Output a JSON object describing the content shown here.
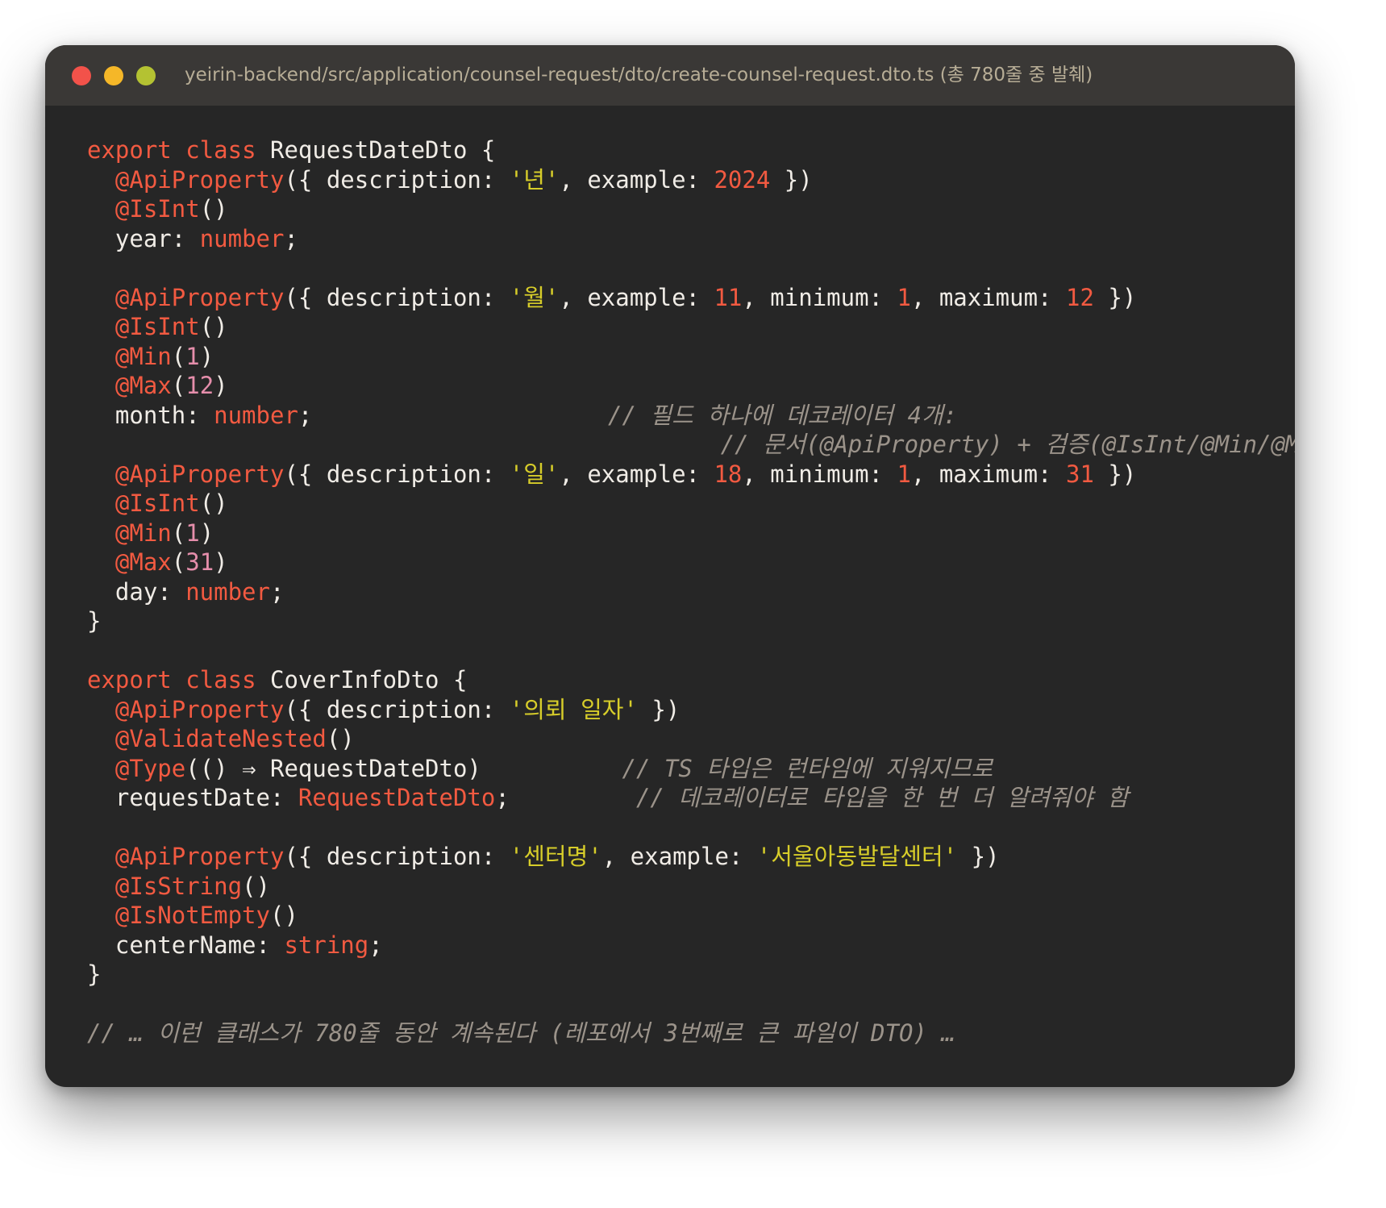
{
  "window": {
    "title": "yeirin-backend/src/application/counsel-request/dto/create-counsel-request.dto.ts (총 780줄 중 발췌)",
    "controls": [
      "close",
      "minimize",
      "zoom"
    ]
  },
  "colors": {
    "background": "#262626",
    "titlebar": "#3a3836",
    "keyword": "#f25a41",
    "string": "#d7cd2a",
    "comment": "#9b938a",
    "text": "#f0ece6"
  },
  "code": {
    "language": "typescript",
    "lines": [
      {
        "segments": [
          {
            "t": "export",
            "k": "kw"
          },
          {
            "t": " "
          },
          {
            "t": "class",
            "k": "kw"
          },
          {
            "t": " RequestDateDto {"
          }
        ]
      },
      {
        "segments": [
          {
            "t": "  "
          },
          {
            "t": "@ApiProperty",
            "k": "dec"
          },
          {
            "t": "({ description: "
          },
          {
            "t": "'년'",
            "k": "str"
          },
          {
            "t": ", example: "
          },
          {
            "t": "2024",
            "k": "num"
          },
          {
            "t": " })"
          }
        ]
      },
      {
        "segments": [
          {
            "t": "  "
          },
          {
            "t": "@IsInt",
            "k": "dec"
          },
          {
            "t": "()"
          }
        ]
      },
      {
        "segments": [
          {
            "t": "  year: "
          },
          {
            "t": "number",
            "k": "ty"
          },
          {
            "t": ";"
          }
        ]
      },
      {
        "segments": []
      },
      {
        "segments": [
          {
            "t": "  "
          },
          {
            "t": "@ApiProperty",
            "k": "dec"
          },
          {
            "t": "({ description: "
          },
          {
            "t": "'월'",
            "k": "str"
          },
          {
            "t": ", example: "
          },
          {
            "t": "11",
            "k": "num"
          },
          {
            "t": ", minimum: "
          },
          {
            "t": "1",
            "k": "num"
          },
          {
            "t": ", maximum: "
          },
          {
            "t": "12",
            "k": "num"
          },
          {
            "t": " })"
          }
        ]
      },
      {
        "segments": [
          {
            "t": "  "
          },
          {
            "t": "@IsInt",
            "k": "dec"
          },
          {
            "t": "()"
          }
        ]
      },
      {
        "segments": [
          {
            "t": "  "
          },
          {
            "t": "@Min",
            "k": "dec"
          },
          {
            "t": "("
          },
          {
            "t": "1",
            "k": "num-arg"
          },
          {
            "t": ")"
          }
        ]
      },
      {
        "segments": [
          {
            "t": "  "
          },
          {
            "t": "@Max",
            "k": "dec"
          },
          {
            "t": "("
          },
          {
            "t": "12",
            "k": "num-arg"
          },
          {
            "t": ")"
          }
        ]
      },
      {
        "segments": [
          {
            "t": "  month: "
          },
          {
            "t": "number",
            "k": "ty"
          },
          {
            "t": ";                     "
          },
          {
            "t": "// 필드 하나에 데코레이터 4개:",
            "k": "cm"
          }
        ]
      },
      {
        "segments": [
          {
            "t": "                                             "
          },
          {
            "t": "// 문서(@ApiProperty) + 검증(@IsInt/@Min/@Max)",
            "k": "cm"
          }
        ]
      },
      {
        "segments": [
          {
            "t": "  "
          },
          {
            "t": "@ApiProperty",
            "k": "dec"
          },
          {
            "t": "({ description: "
          },
          {
            "t": "'일'",
            "k": "str"
          },
          {
            "t": ", example: "
          },
          {
            "t": "18",
            "k": "num"
          },
          {
            "t": ", minimum: "
          },
          {
            "t": "1",
            "k": "num"
          },
          {
            "t": ", maximum: "
          },
          {
            "t": "31",
            "k": "num"
          },
          {
            "t": " })"
          }
        ]
      },
      {
        "segments": [
          {
            "t": "  "
          },
          {
            "t": "@IsInt",
            "k": "dec"
          },
          {
            "t": "()"
          }
        ]
      },
      {
        "segments": [
          {
            "t": "  "
          },
          {
            "t": "@Min",
            "k": "dec"
          },
          {
            "t": "("
          },
          {
            "t": "1",
            "k": "num-arg"
          },
          {
            "t": ")"
          }
        ]
      },
      {
        "segments": [
          {
            "t": "  "
          },
          {
            "t": "@Max",
            "k": "dec"
          },
          {
            "t": "("
          },
          {
            "t": "31",
            "k": "num-arg"
          },
          {
            "t": ")"
          }
        ]
      },
      {
        "segments": [
          {
            "t": "  day: "
          },
          {
            "t": "number",
            "k": "ty"
          },
          {
            "t": ";"
          }
        ]
      },
      {
        "segments": [
          {
            "t": "}"
          }
        ]
      },
      {
        "segments": []
      },
      {
        "segments": [
          {
            "t": "export",
            "k": "kw"
          },
          {
            "t": " "
          },
          {
            "t": "class",
            "k": "kw"
          },
          {
            "t": " CoverInfoDto {"
          }
        ]
      },
      {
        "segments": [
          {
            "t": "  "
          },
          {
            "t": "@ApiProperty",
            "k": "dec"
          },
          {
            "t": "({ description: "
          },
          {
            "t": "'의뢰 일자'",
            "k": "str"
          },
          {
            "t": " })"
          }
        ]
      },
      {
        "segments": [
          {
            "t": "  "
          },
          {
            "t": "@ValidateNested",
            "k": "dec"
          },
          {
            "t": "()"
          }
        ]
      },
      {
        "segments": [
          {
            "t": "  "
          },
          {
            "t": "@Type",
            "k": "dec"
          },
          {
            "t": "(() ⇒ RequestDateDto)          "
          },
          {
            "t": "// TS 타입은 런타임에 지워지므로",
            "k": "cm"
          }
        ]
      },
      {
        "segments": [
          {
            "t": "  requestDate: "
          },
          {
            "t": "RequestDateDto",
            "k": "ty"
          },
          {
            "t": ";         "
          },
          {
            "t": "// 데코레이터로 타입을 한 번 더 알려줘야 함",
            "k": "cm"
          }
        ]
      },
      {
        "segments": []
      },
      {
        "segments": [
          {
            "t": "  "
          },
          {
            "t": "@ApiProperty",
            "k": "dec"
          },
          {
            "t": "({ description: "
          },
          {
            "t": "'센터명'",
            "k": "str"
          },
          {
            "t": ", example: "
          },
          {
            "t": "'서울아동발달센터'",
            "k": "str"
          },
          {
            "t": " })"
          }
        ]
      },
      {
        "segments": [
          {
            "t": "  "
          },
          {
            "t": "@IsString",
            "k": "dec"
          },
          {
            "t": "()"
          }
        ]
      },
      {
        "segments": [
          {
            "t": "  "
          },
          {
            "t": "@IsNotEmpty",
            "k": "dec"
          },
          {
            "t": "()"
          }
        ]
      },
      {
        "segments": [
          {
            "t": "  centerName: "
          },
          {
            "t": "string",
            "k": "ty"
          },
          {
            "t": ";"
          }
        ]
      },
      {
        "segments": [
          {
            "t": "}"
          }
        ]
      },
      {
        "segments": []
      },
      {
        "segments": [
          {
            "t": "// … 이런 클래스가 780줄 동안 계속된다 (레포에서 3번째로 큰 파일이 DTO) …",
            "k": "cm"
          }
        ]
      }
    ]
  }
}
